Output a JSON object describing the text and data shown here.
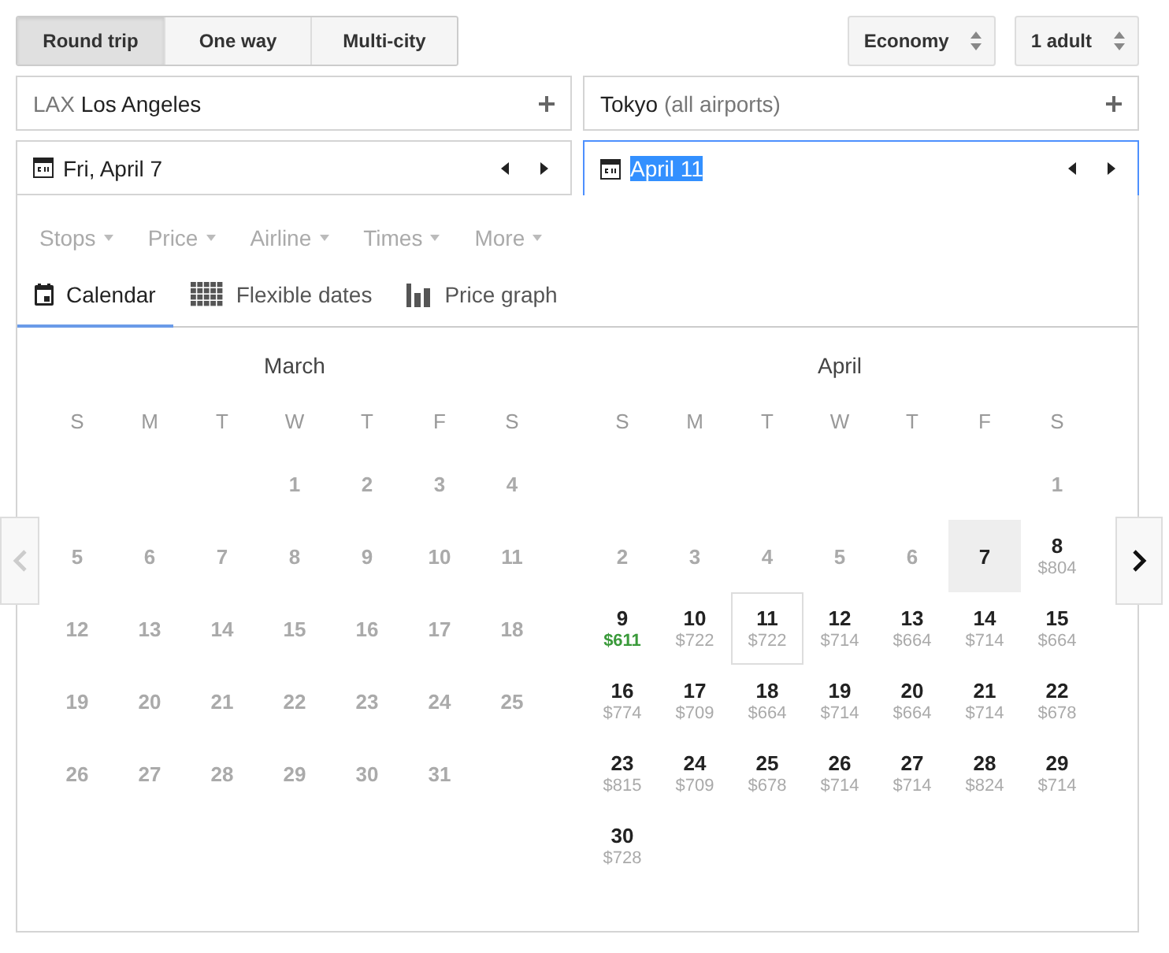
{
  "trip_types": [
    {
      "label": "Round trip",
      "selected": true
    },
    {
      "label": "One way",
      "selected": false
    },
    {
      "label": "Multi-city",
      "selected": false
    }
  ],
  "cabin": "Economy",
  "passengers": "1 adult",
  "origin": {
    "code": "LAX",
    "city": "Los Angeles"
  },
  "destination": {
    "city": "Tokyo",
    "note": "(all airports)"
  },
  "depart_date": {
    "value": "Fri, April 7",
    "focused": false
  },
  "return_date": {
    "value": "April 11",
    "focused": true
  },
  "filters": [
    "Stops",
    "Price",
    "Airline",
    "Times",
    "More"
  ],
  "view_tabs": [
    {
      "label": "Calendar",
      "kind": "calendar",
      "selected": true
    },
    {
      "label": "Flexible dates",
      "kind": "grid",
      "selected": false
    },
    {
      "label": "Price graph",
      "kind": "graph",
      "selected": false
    }
  ],
  "prev_month": {
    "disabled": true
  },
  "next_month": {
    "disabled": false
  },
  "months": [
    {
      "name": "March",
      "weekdays": [
        "S",
        "M",
        "T",
        "W",
        "T",
        "F",
        "S"
      ],
      "days": [
        {
          "kind": "blank"
        },
        {
          "kind": "blank"
        },
        {
          "kind": "blank"
        },
        {
          "day": "1",
          "kind": "past"
        },
        {
          "day": "2",
          "kind": "past"
        },
        {
          "day": "3",
          "kind": "past"
        },
        {
          "day": "4",
          "kind": "past"
        },
        {
          "day": "5",
          "kind": "past"
        },
        {
          "day": "6",
          "kind": "past"
        },
        {
          "day": "7",
          "kind": "past"
        },
        {
          "day": "8",
          "kind": "past"
        },
        {
          "day": "9",
          "kind": "past"
        },
        {
          "day": "10",
          "kind": "past"
        },
        {
          "day": "11",
          "kind": "past"
        },
        {
          "day": "12",
          "kind": "past"
        },
        {
          "day": "13",
          "kind": "past"
        },
        {
          "day": "14",
          "kind": "past"
        },
        {
          "day": "15",
          "kind": "past"
        },
        {
          "day": "16",
          "kind": "past"
        },
        {
          "day": "17",
          "kind": "past"
        },
        {
          "day": "18",
          "kind": "past"
        },
        {
          "day": "19",
          "kind": "past"
        },
        {
          "day": "20",
          "kind": "past"
        },
        {
          "day": "21",
          "kind": "past"
        },
        {
          "day": "22",
          "kind": "past"
        },
        {
          "day": "23",
          "kind": "past"
        },
        {
          "day": "24",
          "kind": "past"
        },
        {
          "day": "25",
          "kind": "past"
        },
        {
          "day": "26",
          "kind": "past"
        },
        {
          "day": "27",
          "kind": "past"
        },
        {
          "day": "28",
          "kind": "past"
        },
        {
          "day": "29",
          "kind": "past"
        },
        {
          "day": "30",
          "kind": "past"
        },
        {
          "day": "31",
          "kind": "past"
        }
      ]
    },
    {
      "name": "April",
      "weekdays": [
        "S",
        "M",
        "T",
        "W",
        "T",
        "F",
        "S"
      ],
      "days": [
        {
          "kind": "blank"
        },
        {
          "kind": "blank"
        },
        {
          "kind": "blank"
        },
        {
          "kind": "blank"
        },
        {
          "kind": "blank"
        },
        {
          "kind": "blank"
        },
        {
          "day": "1",
          "kind": "past"
        },
        {
          "day": "2",
          "kind": "past"
        },
        {
          "day": "3",
          "kind": "past"
        },
        {
          "day": "4",
          "kind": "past"
        },
        {
          "day": "5",
          "kind": "past"
        },
        {
          "day": "6",
          "kind": "past"
        },
        {
          "day": "7",
          "kind": "departure"
        },
        {
          "day": "8",
          "price": "$804",
          "kind": "fare",
          "cheapest": false
        },
        {
          "day": "9",
          "price": "$611",
          "kind": "fare",
          "cheapest": true
        },
        {
          "day": "10",
          "price": "$722",
          "kind": "fare",
          "cheapest": false
        },
        {
          "day": "11",
          "price": "$722",
          "kind": "return",
          "cheapest": false
        },
        {
          "day": "12",
          "price": "$714",
          "kind": "fare",
          "cheapest": false
        },
        {
          "day": "13",
          "price": "$664",
          "kind": "fare",
          "cheapest": false
        },
        {
          "day": "14",
          "price": "$714",
          "kind": "fare",
          "cheapest": false
        },
        {
          "day": "15",
          "price": "$664",
          "kind": "fare",
          "cheapest": false
        },
        {
          "day": "16",
          "price": "$774",
          "kind": "fare",
          "cheapest": false
        },
        {
          "day": "17",
          "price": "$709",
          "kind": "fare",
          "cheapest": false
        },
        {
          "day": "18",
          "price": "$664",
          "kind": "fare",
          "cheapest": false
        },
        {
          "day": "19",
          "price": "$714",
          "kind": "fare",
          "cheapest": false
        },
        {
          "day": "20",
          "price": "$664",
          "kind": "fare",
          "cheapest": false
        },
        {
          "day": "21",
          "price": "$714",
          "kind": "fare",
          "cheapest": false
        },
        {
          "day": "22",
          "price": "$678",
          "kind": "fare",
          "cheapest": false
        },
        {
          "day": "23",
          "price": "$815",
          "kind": "fare",
          "cheapest": false
        },
        {
          "day": "24",
          "price": "$709",
          "kind": "fare",
          "cheapest": false
        },
        {
          "day": "25",
          "price": "$678",
          "kind": "fare",
          "cheapest": false
        },
        {
          "day": "26",
          "price": "$714",
          "kind": "fare",
          "cheapest": false
        },
        {
          "day": "27",
          "price": "$714",
          "kind": "fare",
          "cheapest": false
        },
        {
          "day": "28",
          "price": "$824",
          "kind": "fare",
          "cheapest": false
        },
        {
          "day": "29",
          "price": "$714",
          "kind": "fare",
          "cheapest": false
        },
        {
          "day": "30",
          "price": "$728",
          "kind": "fare",
          "cheapest": false
        }
      ]
    }
  ]
}
